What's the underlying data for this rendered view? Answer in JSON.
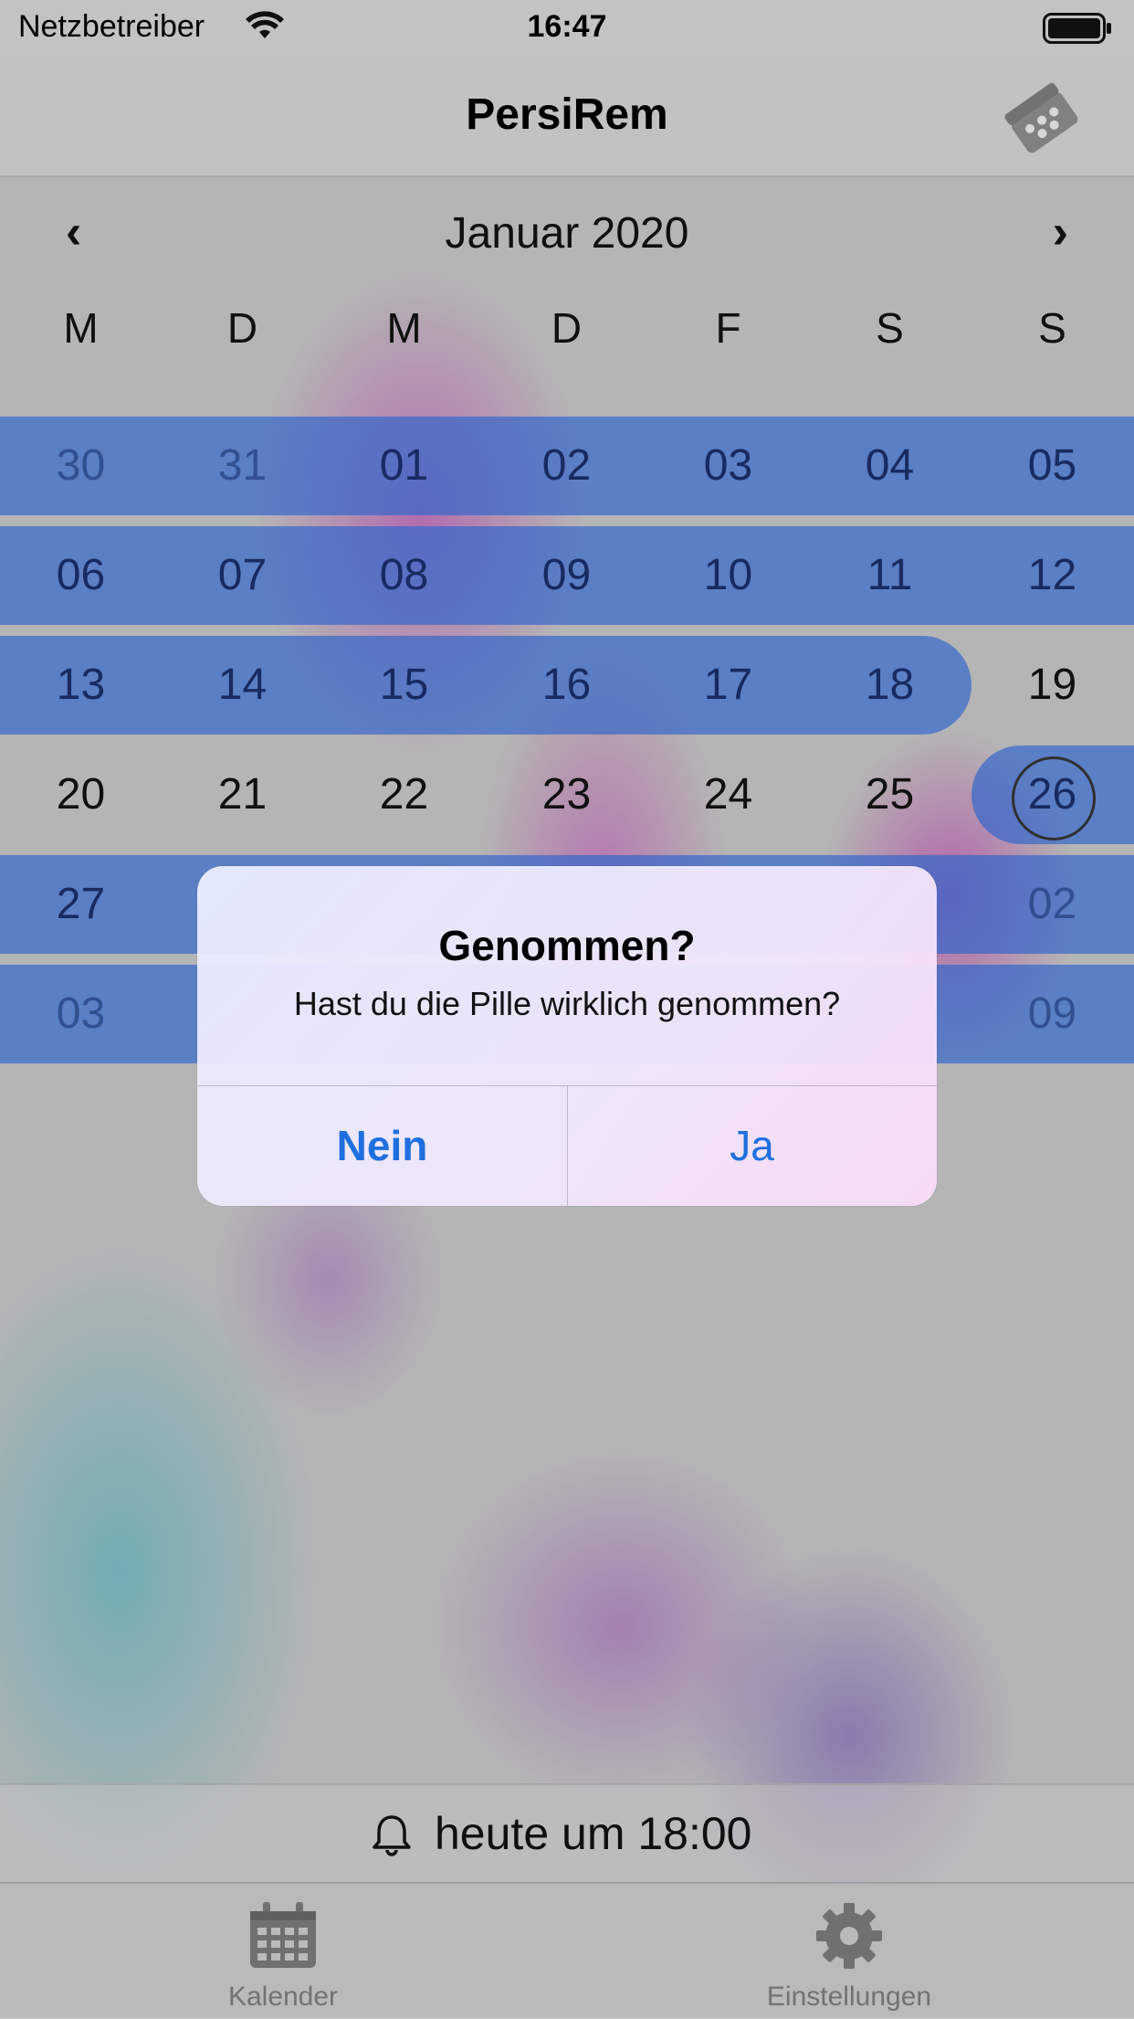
{
  "status_bar": {
    "carrier": "Netzbetreiber",
    "time": "16:47"
  },
  "nav": {
    "title": "PersiRem",
    "right_icon": "pill-pack-icon"
  },
  "calendar": {
    "month_label": "Januar  2020",
    "prev_icon": "chevron-left-icon",
    "next_icon": "chevron-right-icon",
    "weekdays": [
      "M",
      "D",
      "M",
      "D",
      "F",
      "S",
      "S"
    ],
    "weeks": [
      [
        "30",
        "31",
        "01",
        "02",
        "03",
        "04",
        "05"
      ],
      [
        "06",
        "07",
        "08",
        "09",
        "10",
        "11",
        "12"
      ],
      [
        "13",
        "14",
        "15",
        "16",
        "17",
        "18",
        "19"
      ],
      [
        "20",
        "21",
        "22",
        "23",
        "24",
        "25",
        "26"
      ],
      [
        "27",
        "",
        "",
        "",
        "",
        "",
        "02"
      ],
      [
        "03",
        "",
        "",
        "",
        "",
        "",
        "09"
      ]
    ],
    "today": "26",
    "highlight_color": "#376ed7"
  },
  "alert": {
    "title": "Genommen?",
    "message": "Hast du die Pille wirklich genommen?",
    "button_no": "Nein",
    "button_yes": "Ja",
    "button_color": "#1f6fe0"
  },
  "reminder": {
    "icon": "bell-icon",
    "text": "heute um 18:00"
  },
  "tabbar": {
    "tabs": [
      {
        "label": "Kalender",
        "icon": "calendar-icon"
      },
      {
        "label": "Einstellungen",
        "icon": "gear-icon"
      }
    ]
  }
}
